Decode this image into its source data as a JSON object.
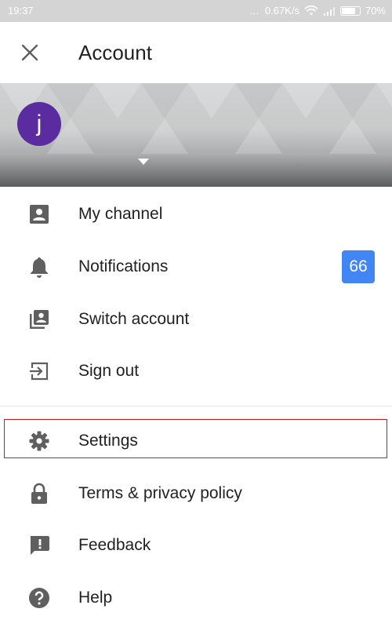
{
  "status_bar": {
    "time": "19:37",
    "network_speed": "0.67K/s",
    "battery": "70%"
  },
  "app_bar": {
    "title": "Account"
  },
  "account": {
    "avatar_letter": "j"
  },
  "menu": {
    "my_channel": "My channel",
    "notifications": "Notifications",
    "notifications_count": "66",
    "switch_account": "Switch account",
    "sign_out": "Sign out",
    "settings": "Settings",
    "terms": "Terms & privacy policy",
    "feedback": "Feedback",
    "help": "Help"
  },
  "colors": {
    "avatar_bg": "#5a2ca0",
    "badge_bg": "#4285f4",
    "icon_gray": "#5f5f5f",
    "highlight_outline": "#d01818"
  }
}
